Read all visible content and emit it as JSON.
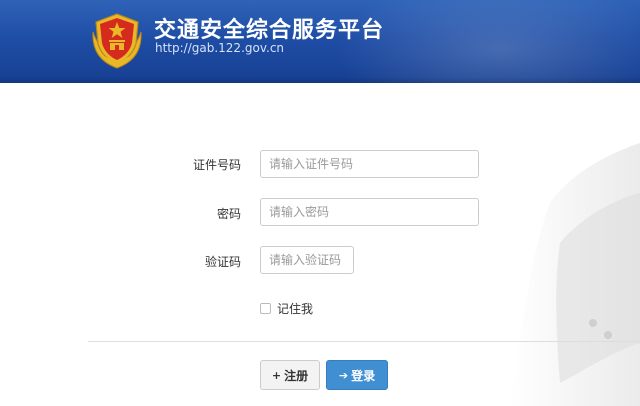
{
  "header": {
    "title": "交通安全综合服务平台",
    "url": "http://gab.122.gov.cn",
    "emblem_icon": "police-emblem-icon",
    "colors": {
      "banner": "#1f4ea6",
      "emblem_red": "#d52b1e",
      "emblem_gold": "#e8b829"
    }
  },
  "form": {
    "id_label": "证件号码",
    "id_placeholder": "请输入证件号码",
    "password_label": "密码",
    "password_placeholder": "请输入密码",
    "captcha_label": "验证码",
    "captcha_placeholder": "请输入验证码",
    "remember_label": "记住我",
    "remember_checked": false
  },
  "actions": {
    "register_icon": "+",
    "register_label": "注册",
    "login_icon": "➔",
    "login_label": "登录",
    "login_color": "#3f8fd2"
  }
}
